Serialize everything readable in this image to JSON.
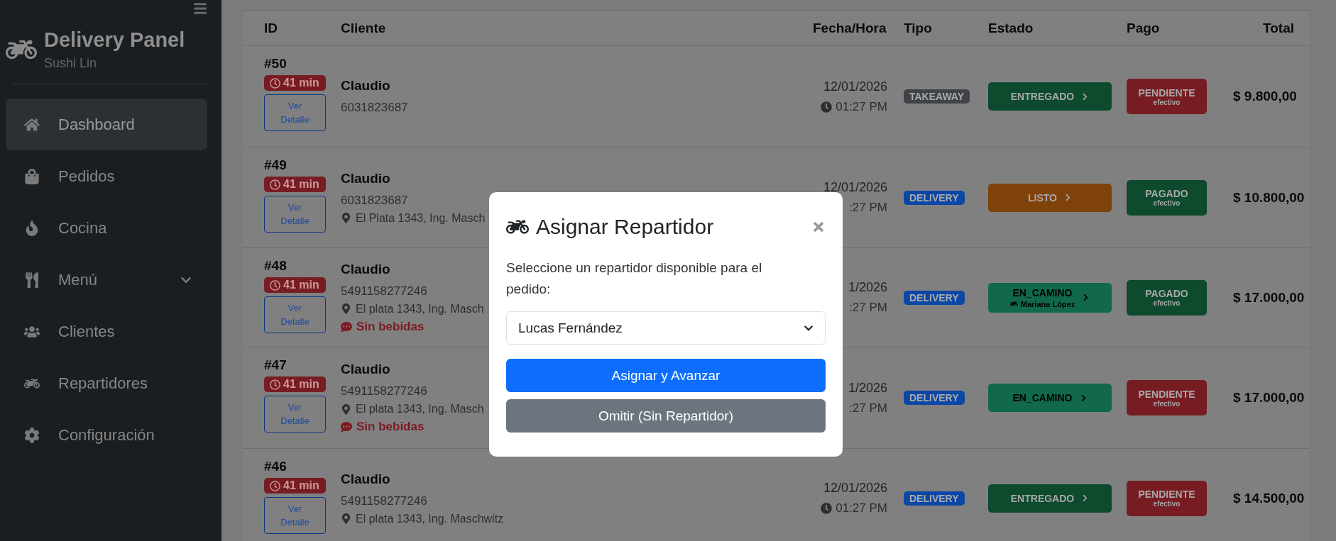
{
  "sidebar": {
    "brand": "Delivery Panel",
    "subtitle": "Sushi Lin",
    "items": [
      {
        "label": "Dashboard",
        "selected": true
      },
      {
        "label": "Pedidos",
        "selected": false
      },
      {
        "label": "Cocina",
        "selected": false
      },
      {
        "label": "Menú",
        "selected": false,
        "expanded": false
      },
      {
        "label": "Clientes",
        "selected": false
      },
      {
        "label": "Repartidores",
        "selected": false
      },
      {
        "label": "Configuración",
        "selected": false
      }
    ]
  },
  "table": {
    "columns": [
      "ID",
      "Cliente",
      "Fecha/Hora",
      "Tipo",
      "Estado",
      "Pago",
      "Total"
    ],
    "rows": [
      {
        "id": "#50",
        "elapsed": "41 min",
        "detail": "Ver Detalle",
        "name": "Claudio",
        "phone": "6031823687",
        "date": "12/01/2026",
        "time": "01:27 PM",
        "time_icon": true,
        "tipo": {
          "label": "TAKEAWAY",
          "color": "#3f4246"
        },
        "estado": {
          "label": "ENTREGADO",
          "color": "#0d4a2e"
        },
        "pago": {
          "label": "PENDIENTE",
          "method": "efectivo",
          "color": "#781c23"
        },
        "total": "$ 9.800,00"
      },
      {
        "id": "#49",
        "elapsed": "41 min",
        "detail": "Ver Detalle",
        "name": "Claudio",
        "phone": "6031823687",
        "address": "El Plata 1343, Ing. Masch",
        "date": "12/01/2026",
        "time": ":27 PM",
        "time_icon": false,
        "tipo": {
          "label": "DELIVERY",
          "color": "#0b47a6"
        },
        "estado": {
          "label": "LISTO",
          "color": "#80420b"
        },
        "pago": {
          "label": "PAGADO",
          "method": "efectivo",
          "color": "#0d4a2e"
        },
        "total": "$ 10.800,00"
      },
      {
        "id": "#48",
        "elapsed": "41 min",
        "detail": "Ver Detalle",
        "name": "Claudio",
        "phone": "5491158277246",
        "address": "El plata 1343, Ing. Masch",
        "note": "Sin bebidas",
        "date": "1/2026",
        "time": ":27 PM",
        "time_icon": false,
        "tipo": {
          "label": "DELIVERY",
          "color": "#0b47a6"
        },
        "estado": {
          "label": "EN_CAMINO",
          "rider": "Mariana López",
          "color": "#12684d"
        },
        "pago": {
          "label": "PAGADO",
          "method": "efectivo",
          "color": "#0d4a2e"
        },
        "total": "$ 17.000,00"
      },
      {
        "id": "#47",
        "elapsed": "41 min",
        "detail": "Ver Detalle",
        "name": "Claudio",
        "phone": "5491158277246",
        "address": "El plata 1343, Ing. Masch",
        "note": "Sin bebidas",
        "date": "1/2026",
        "time": ":27 PM",
        "time_icon": false,
        "tipo": {
          "label": "DELIVERY",
          "color": "#0b47a6"
        },
        "estado": {
          "label": "EN_CAMINO",
          "color": "#12684d"
        },
        "pago": {
          "label": "PENDIENTE",
          "method": "efectivo",
          "color": "#781c23"
        },
        "total": "$ 17.000,00"
      },
      {
        "id": "#46",
        "elapsed": "41 min",
        "detail": "Ver Detalle",
        "name": "Claudio",
        "phone": "5491158277246",
        "address": "El plata 1343, Ing. Maschwitz",
        "date": "12/01/2026",
        "time": "01:27 PM",
        "time_icon": true,
        "tipo": {
          "label": "DELIVERY",
          "color": "#0b47a6"
        },
        "estado": {
          "label": "ENTREGADO",
          "color": "#0d4a2e"
        },
        "pago": {
          "label": "PENDIENTE",
          "method": "efectivo",
          "color": "#781c23"
        },
        "total": "$ 14.500,00"
      }
    ]
  },
  "modal": {
    "title": "Asignar Repartidor",
    "message": "Seleccione un repartidor disponible para el pedido:",
    "select": {
      "value": "Lucas Fernández"
    },
    "buttons": [
      {
        "kind": "primary",
        "label": "Asignar y Avanzar"
      },
      {
        "kind": "secondary",
        "label": "Omitir (Sin Repartidor)"
      }
    ]
  }
}
